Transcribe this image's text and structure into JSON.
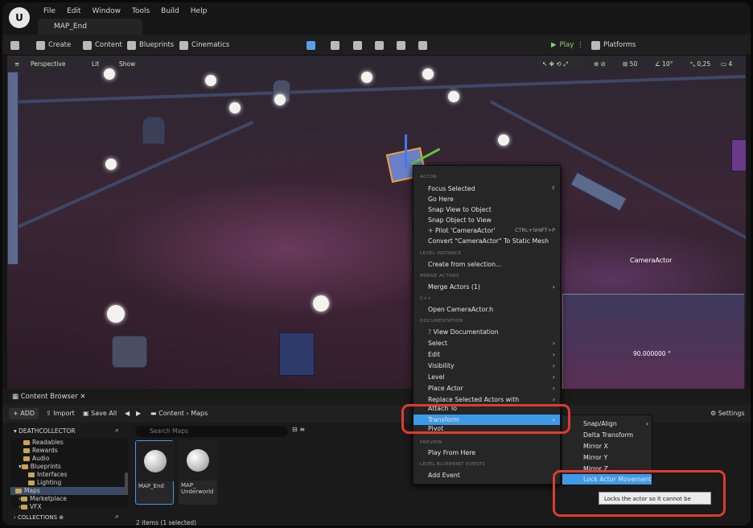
{
  "menu": [
    "File",
    "Edit",
    "Window",
    "Tools",
    "Build",
    "Help"
  ],
  "doc_tab": "MAP_End",
  "toolbar": {
    "create": "Create",
    "content": "Content",
    "blueprints": "Blueprints",
    "cinematics": "Cinematics",
    "play": "Play",
    "platforms": "Platforms"
  },
  "viewport": {
    "perspective": "Perspective",
    "lit": "Lit",
    "show": "Show",
    "grid": "50",
    "angle": "10°",
    "scale": "0,25",
    "cams": "4",
    "camera_label": "CameraActor",
    "fov_readout": "90.000000 °"
  },
  "context_menu": {
    "actor_header": "ACTOR",
    "focus": "Focus Selected",
    "focus_sc": "F",
    "go_here": "Go Here",
    "snap_view": "Snap View to Object",
    "snap_obj": "Snap Object to View",
    "pilot": "Pilot 'CameraActor'",
    "pilot_sc": "CTRL+SHIFT+P",
    "convert": "Convert \"CameraActor\" To Static Mesh",
    "level_instance_header": "LEVEL INSTANCE",
    "create_sel": "Create from selection...",
    "merge_header": "MERGE ACTORS",
    "merge": "Merge Actors (1)",
    "cpp_header": "C++",
    "open_h": "Open CameraActor.h",
    "doc_header": "DOCUMENTATION",
    "view_doc": "View Documentation",
    "select": "Select",
    "edit": "Edit",
    "visibility": "Visibility",
    "level": "Level",
    "place": "Place Actor",
    "replace": "Replace Selected Actors with",
    "attach": "Attach To",
    "transform": "Transform",
    "pivot": "Pivot",
    "preview_header": "PREVIEW",
    "play_here": "Play From Here",
    "lbe_header": "LEVEL BLUEPRINT EVENTS",
    "add_event": "Add Event"
  },
  "transform_submenu": [
    "Snap/Align",
    "Delta Transform",
    "Mirror X",
    "Mirror Y",
    "Mirror Z",
    "Lock Actor Movement"
  ],
  "tooltip": "Locks the actor so it cannot be moved",
  "content_browser": {
    "tab": "Content Browser",
    "add": "ADD",
    "import": "Import",
    "save_all": "Save All",
    "path_content": "Content",
    "path_maps": "Maps",
    "settings": "Settings",
    "project": "DEATHCOLLECTOR",
    "tree": [
      "Readables",
      "Rewards",
      "Audio",
      "Blueprints",
      "Interfaces",
      "Lighting",
      "Maps",
      "Marketplace",
      "VFX"
    ],
    "collections": "COLLECTIONS",
    "search_placeholder": "Search Maps",
    "assets": [
      "MAP_End",
      "MAP_ Underworld"
    ],
    "status": "2 items (1 selected)"
  },
  "colors": {
    "highlight": "#3f9ae6",
    "annotation_red": "#e03a30",
    "play_green": "#8fd16a"
  }
}
